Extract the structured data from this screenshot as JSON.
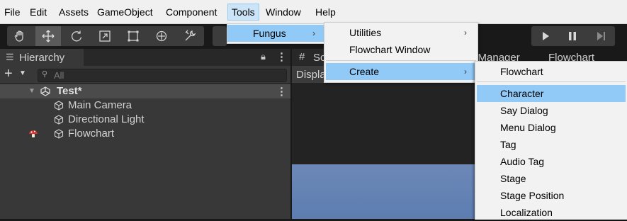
{
  "menubar": {
    "items": [
      "File",
      "Edit",
      "Assets",
      "GameObject",
      "Component",
      "Tools",
      "Window",
      "Help"
    ]
  },
  "hierarchy": {
    "tab_label": "Hierarchy",
    "search_placeholder": "All",
    "scene_name": "Test*",
    "objects": [
      "Main Camera",
      "Directional Light",
      "Flowchart"
    ]
  },
  "scene": {
    "tab_label": "Sc",
    "sub_label": "Displa",
    "right_tabs": [
      "e Manager",
      "Flowchart"
    ]
  },
  "tools_menu": {
    "items": [
      "Fungus"
    ]
  },
  "fungus_menu": {
    "items": [
      "Utilities",
      "Flowchart Window",
      "Create"
    ]
  },
  "create_menu": {
    "items": [
      "Flowchart",
      "Character",
      "Say Dialog",
      "Menu Dialog",
      "Tag",
      "Audio Tag",
      "Stage",
      "Stage Position",
      "Localization"
    ]
  },
  "colors": {
    "highlight": "#91c9f7",
    "menubar_active": "#cce4f7",
    "panel": "#383838"
  }
}
